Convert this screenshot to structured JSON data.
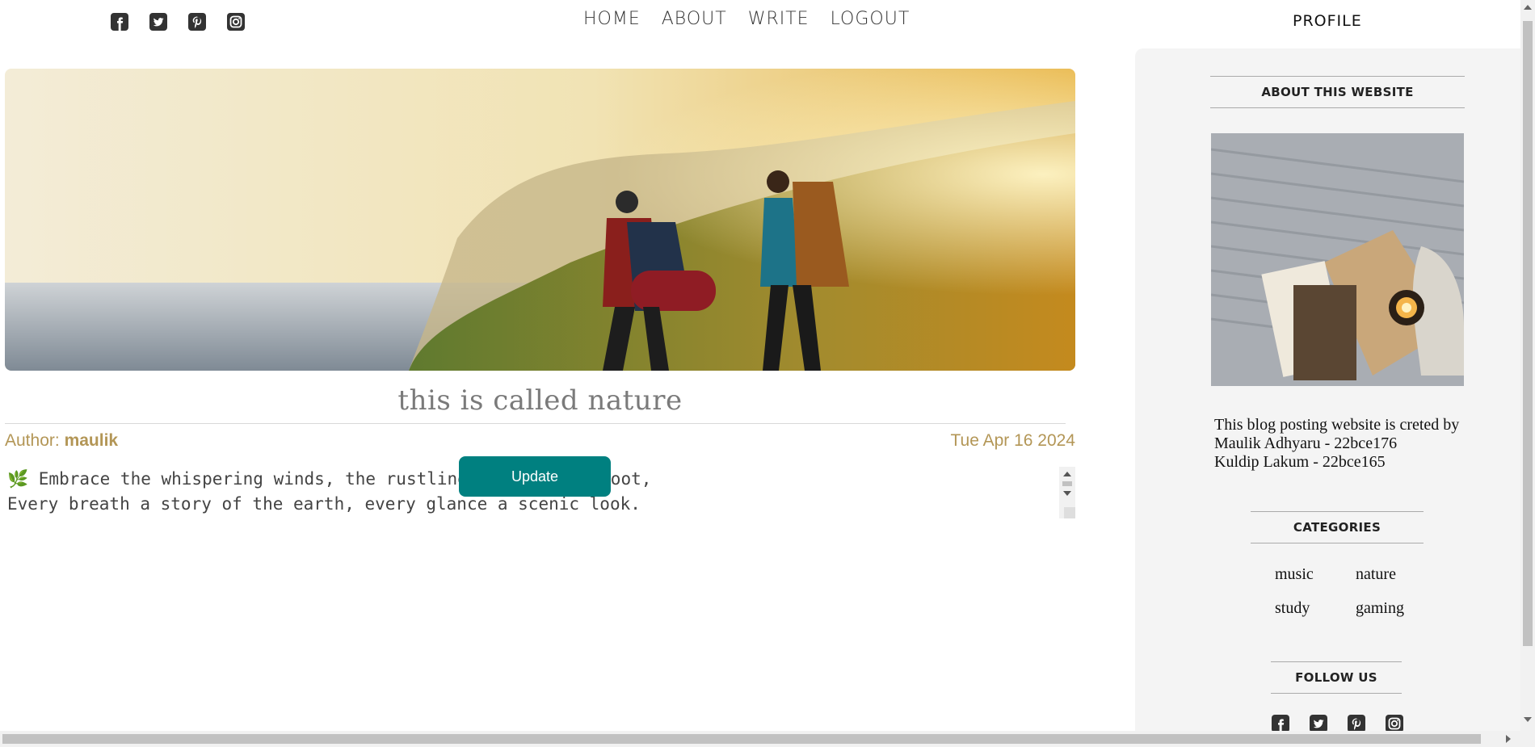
{
  "nav": {
    "items": [
      "HOME",
      "ABOUT",
      "WRITE",
      "LOGOUT"
    ],
    "profile_label": "PROFILE"
  },
  "social_icons": [
    "facebook-icon",
    "twitter-icon",
    "pinterest-icon",
    "instagram-icon"
  ],
  "post": {
    "title": "this is called nature",
    "author_label": "Author:",
    "author_name": "maulik",
    "date": "Tue Apr 16 2024",
    "body_line1": "🌿 Embrace the whispering winds, the rustling leaves underfoot,",
    "body_line2": "Every breath a story of the earth, every glance a scenic look.",
    "update_label": "Update"
  },
  "sidebar": {
    "about_title": "ABOUT THIS WEBSITE",
    "about_line1": "This blog posting website is creted by",
    "about_line2": "Maulik Adhyaru - 22bce176",
    "about_line3": "Kuldip Lakum - 22bce165",
    "categories_title": "CATEGORIES",
    "categories": [
      "music",
      "nature",
      "study",
      "gaming"
    ],
    "follow_title": "FOLLOW US"
  },
  "colors": {
    "accent": "#008080",
    "meta": "#b39656",
    "sidebar_bg": "#f4f4f4"
  }
}
